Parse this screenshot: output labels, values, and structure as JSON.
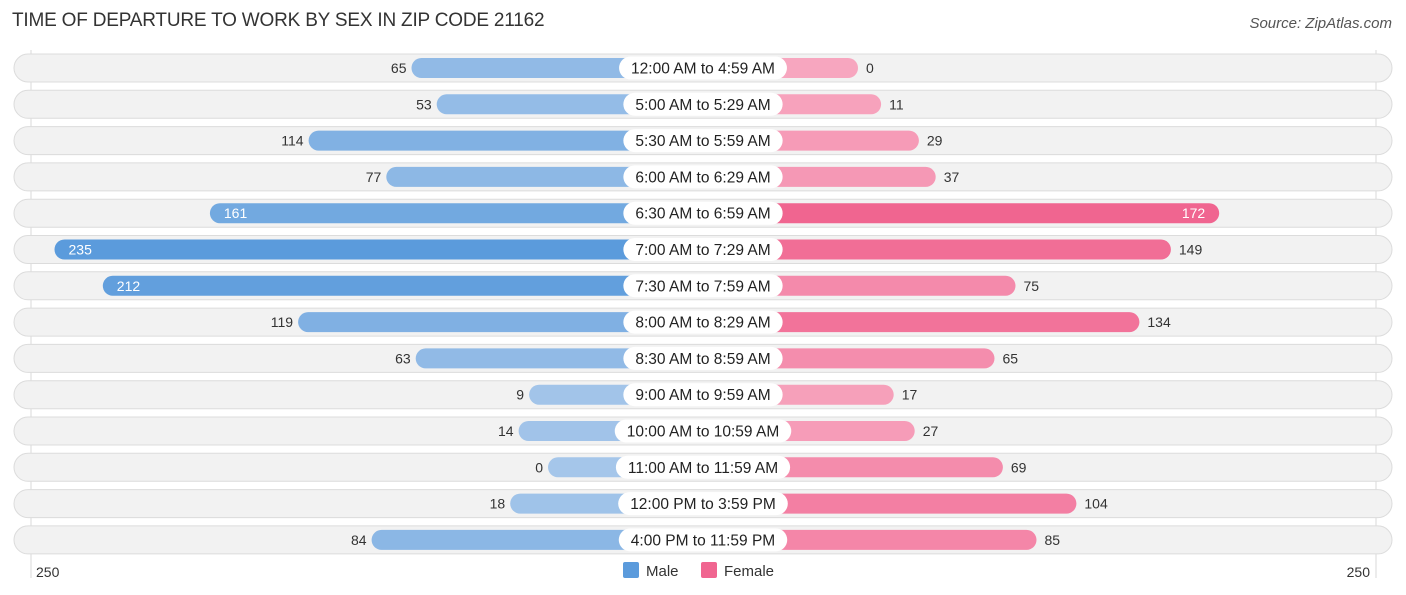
{
  "title": "TIME OF DEPARTURE TO WORK BY SEX IN ZIP CODE 21162",
  "source": "Source: ZipAtlas.com",
  "colors": {
    "male_strong": "#5b9bdc",
    "male_light": "#a5c6ea",
    "female_strong": "#f06590",
    "female_light": "#f7a6bf"
  },
  "chart_data": {
    "type": "bar",
    "orientation": "horizontal-diverging",
    "title": "TIME OF DEPARTURE TO WORK BY SEX IN ZIP CODE 21162",
    "categories": [
      "12:00 AM to 4:59 AM",
      "5:00 AM to 5:29 AM",
      "5:30 AM to 5:59 AM",
      "6:00 AM to 6:29 AM",
      "6:30 AM to 6:59 AM",
      "7:00 AM to 7:29 AM",
      "7:30 AM to 7:59 AM",
      "8:00 AM to 8:29 AM",
      "8:30 AM to 8:59 AM",
      "9:00 AM to 9:59 AM",
      "10:00 AM to 10:59 AM",
      "11:00 AM to 11:59 AM",
      "12:00 PM to 3:59 PM",
      "4:00 PM to 11:59 PM"
    ],
    "series": [
      {
        "name": "Male",
        "values": [
          65,
          53,
          114,
          77,
          161,
          235,
          212,
          119,
          63,
          9,
          14,
          0,
          18,
          84
        ]
      },
      {
        "name": "Female",
        "values": [
          0,
          11,
          29,
          37,
          172,
          149,
          75,
          134,
          65,
          17,
          27,
          69,
          104,
          85
        ]
      }
    ],
    "axis": {
      "left_label": "250",
      "right_label": "250",
      "max": 250
    },
    "legend": {
      "position": "bottom-center",
      "entries": [
        "Male",
        "Female"
      ]
    }
  }
}
